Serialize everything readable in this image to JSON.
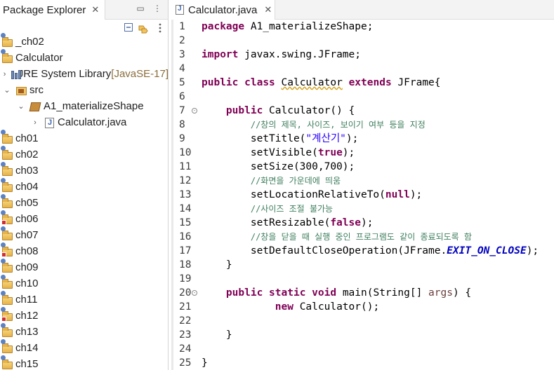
{
  "explorer": {
    "tab_label": "Package Explorer",
    "close_glyph": "✕",
    "minimize_glyph": "▭",
    "maximize_glyph": "⋮",
    "items": [
      {
        "label": "_ch02",
        "indent": 0,
        "twisty": "",
        "icon": "project-icon"
      },
      {
        "label": "Calculator",
        "indent": 0,
        "twisty": "",
        "icon": "project-icon"
      },
      {
        "label": "JRE System Library",
        "suffix": "[JavaSE-17]",
        "indent": 1,
        "twisty": "›",
        "icon": "library-icon"
      },
      {
        "label": "src",
        "indent": 1,
        "twisty": "⌄",
        "icon": "source-folder-icon"
      },
      {
        "label": "A1_materializeShape",
        "indent": 2,
        "twisty": "⌄",
        "icon": "package-icon"
      },
      {
        "label": "Calculator.java",
        "indent": 3,
        "twisty": "›",
        "icon": "java-file-icon"
      },
      {
        "label": "ch01",
        "indent": 0,
        "twisty": "",
        "icon": "project-icon"
      },
      {
        "label": "ch02",
        "indent": 0,
        "twisty": "",
        "icon": "project-icon"
      },
      {
        "label": "ch03",
        "indent": 0,
        "twisty": "",
        "icon": "project-icon"
      },
      {
        "label": "ch04",
        "indent": 0,
        "twisty": "",
        "icon": "project-icon"
      },
      {
        "label": "ch05",
        "indent": 0,
        "twisty": "",
        "icon": "project-icon"
      },
      {
        "label": "ch06",
        "indent": 0,
        "twisty": "",
        "icon": "project-error-icon"
      },
      {
        "label": "ch07",
        "indent": 0,
        "twisty": "",
        "icon": "project-icon"
      },
      {
        "label": "ch08",
        "indent": 0,
        "twisty": "",
        "icon": "project-error-icon"
      },
      {
        "label": "ch09",
        "indent": 0,
        "twisty": "",
        "icon": "project-icon"
      },
      {
        "label": "ch10",
        "indent": 0,
        "twisty": "",
        "icon": "project-icon"
      },
      {
        "label": "ch11",
        "indent": 0,
        "twisty": "",
        "icon": "project-icon"
      },
      {
        "label": "ch12",
        "indent": 0,
        "twisty": "",
        "icon": "project-error-icon"
      },
      {
        "label": "ch13",
        "indent": 0,
        "twisty": "",
        "icon": "project-icon"
      },
      {
        "label": "ch14",
        "indent": 0,
        "twisty": "",
        "icon": "project-icon"
      },
      {
        "label": "ch15",
        "indent": 0,
        "twisty": "",
        "icon": "project-icon"
      }
    ]
  },
  "editor": {
    "tab_label": "Calculator.java",
    "close_glyph": "✕",
    "lines": [
      {
        "n": "1",
        "fold": "",
        "tokens": [
          [
            "kw",
            "package"
          ],
          [
            "t",
            " A1_materializeShape;"
          ]
        ]
      },
      {
        "n": "2",
        "fold": "",
        "tokens": []
      },
      {
        "n": "3",
        "fold": "",
        "tokens": [
          [
            "kw",
            "import"
          ],
          [
            "t",
            " javax.swing.JFrame;"
          ]
        ]
      },
      {
        "n": "4",
        "fold": "",
        "tokens": []
      },
      {
        "n": "5",
        "fold": "",
        "tokens": [
          [
            "kw",
            "public"
          ],
          [
            "t",
            " "
          ],
          [
            "kw",
            "class"
          ],
          [
            "t",
            " "
          ],
          [
            "warn",
            "Calculator"
          ],
          [
            "t",
            " "
          ],
          [
            "kw",
            "extends"
          ],
          [
            "t",
            " JFrame{"
          ]
        ]
      },
      {
        "n": "6",
        "fold": "",
        "tokens": []
      },
      {
        "n": "7",
        "fold": "⊖",
        "tokens": [
          [
            "t",
            "    "
          ],
          [
            "kw",
            "public"
          ],
          [
            "t",
            " Calculator() {"
          ]
        ]
      },
      {
        "n": "8",
        "fold": "",
        "tokens": [
          [
            "t",
            "        "
          ],
          [
            "cm",
            "//창의 제목, 사이즈, 보이기 여부 등을 지정"
          ]
        ]
      },
      {
        "n": "9",
        "fold": "",
        "tokens": [
          [
            "t",
            "        setTitle("
          ],
          [
            "st",
            "\"계산기\""
          ],
          [
            "t",
            ");"
          ]
        ]
      },
      {
        "n": "10",
        "fold": "",
        "tokens": [
          [
            "t",
            "        setVisible("
          ],
          [
            "kw",
            "true"
          ],
          [
            "t",
            ");"
          ]
        ]
      },
      {
        "n": "11",
        "fold": "",
        "tokens": [
          [
            "t",
            "        setSize(300,700);"
          ]
        ]
      },
      {
        "n": "12",
        "fold": "",
        "tokens": [
          [
            "t",
            "        "
          ],
          [
            "cm",
            "//화면을 가운데에 띄움"
          ]
        ]
      },
      {
        "n": "13",
        "fold": "",
        "tokens": [
          [
            "t",
            "        setLocationRelativeTo("
          ],
          [
            "kw",
            "null"
          ],
          [
            "t",
            ");"
          ]
        ]
      },
      {
        "n": "14",
        "fold": "",
        "tokens": [
          [
            "t",
            "        "
          ],
          [
            "cm",
            "//사이즈 조절 불가능"
          ]
        ]
      },
      {
        "n": "15",
        "fold": "",
        "tokens": [
          [
            "t",
            "        setResizable("
          ],
          [
            "kw",
            "false"
          ],
          [
            "t",
            ");"
          ]
        ]
      },
      {
        "n": "16",
        "fold": "",
        "tokens": [
          [
            "t",
            "        "
          ],
          [
            "cm",
            "//창을 닫을 때 실행 중인 프로그램도 같이 종료되도록 함"
          ]
        ]
      },
      {
        "n": "17",
        "fold": "",
        "tokens": [
          [
            "t",
            "        setDefaultCloseOperation(JFrame."
          ],
          [
            "fd",
            "EXIT_ON_CLOSE"
          ],
          [
            "t",
            ");"
          ]
        ]
      },
      {
        "n": "18",
        "fold": "",
        "tokens": [
          [
            "t",
            "    }"
          ]
        ]
      },
      {
        "n": "19",
        "fold": "",
        "tokens": []
      },
      {
        "n": "20",
        "fold": "⊖",
        "tokens": [
          [
            "t",
            "    "
          ],
          [
            "kw",
            "public"
          ],
          [
            "t",
            " "
          ],
          [
            "kw",
            "static"
          ],
          [
            "t",
            " "
          ],
          [
            "kw",
            "void"
          ],
          [
            "t",
            " main(String[] "
          ],
          [
            "pm",
            "args"
          ],
          [
            "t",
            ") {"
          ]
        ]
      },
      {
        "n": "21",
        "fold": "",
        "tokens": [
          [
            "t",
            "            "
          ],
          [
            "kw",
            "new"
          ],
          [
            "t",
            " Calculator();"
          ]
        ]
      },
      {
        "n": "22",
        "fold": "",
        "tokens": []
      },
      {
        "n": "23",
        "fold": "",
        "tokens": [
          [
            "t",
            "    }"
          ]
        ]
      },
      {
        "n": "24",
        "fold": "",
        "tokens": []
      },
      {
        "n": "25",
        "fold": "",
        "tokens": [
          [
            "t",
            "}"
          ]
        ]
      }
    ]
  }
}
